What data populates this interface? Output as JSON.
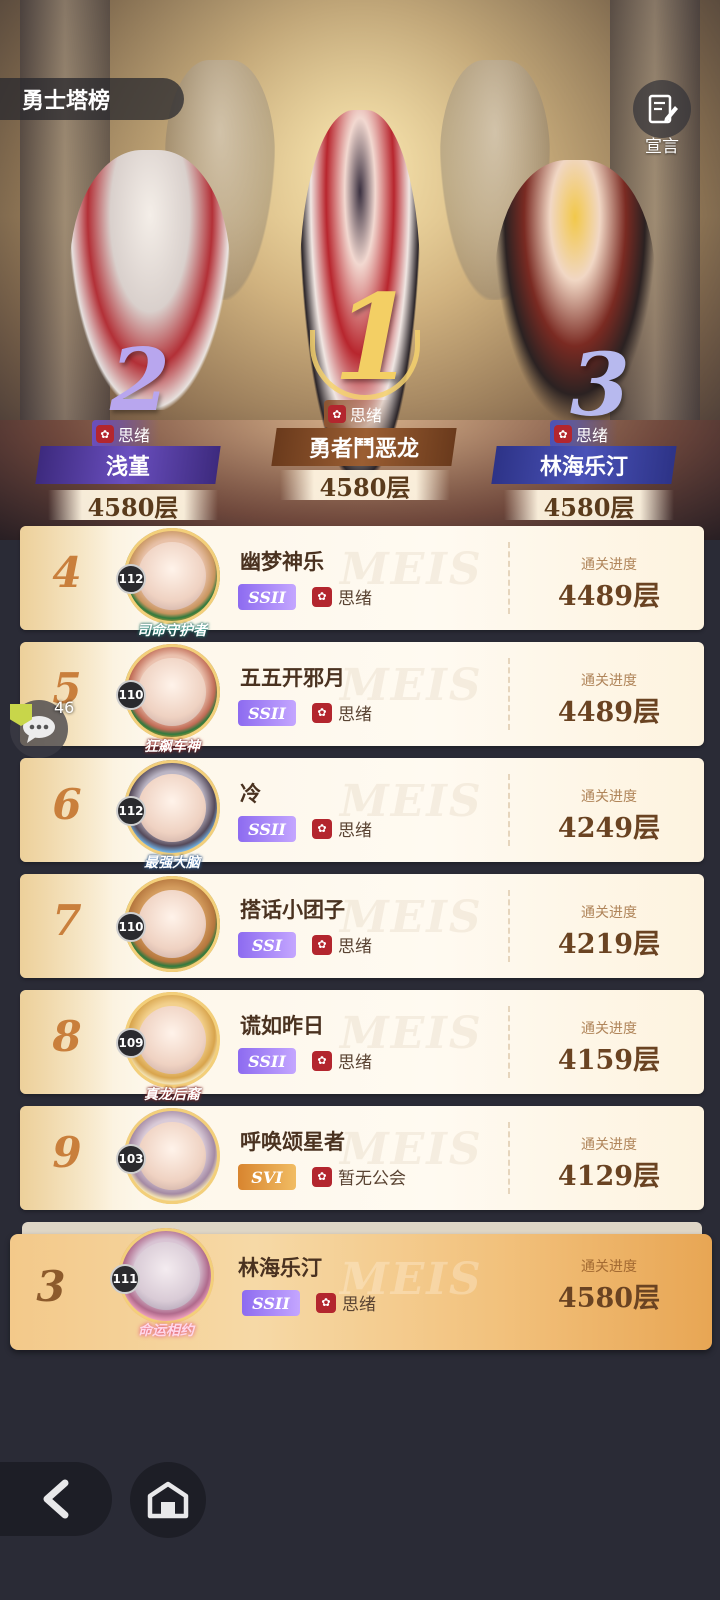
{
  "header": {
    "title": "勇士塔榜",
    "declare_label": "宣言"
  },
  "podium": [
    {
      "rank": "2",
      "guild": "思绪",
      "name": "浅堇",
      "floors": "4580层",
      "accent": "#5a3fa4"
    },
    {
      "rank": "1",
      "guild": "思绪",
      "name": "勇者鬥恶龙",
      "floors": "4580层",
      "accent": "#8a4b25"
    },
    {
      "rank": "3",
      "guild": "思绪",
      "name": "林海乐汀",
      "floors": "4580层",
      "accent": "#3f47a8"
    }
  ],
  "progress_label": "通关进度",
  "rows": [
    {
      "rank": "4",
      "level": "112",
      "name": "幽梦神乐",
      "tier": "SSII",
      "guild": "思绪",
      "floors": "4489层",
      "ribbon": "司命守护者",
      "tier_color": "purple"
    },
    {
      "rank": "5",
      "level": "110",
      "name": "五五开邪月",
      "tier": "SSII",
      "guild": "思绪",
      "floors": "4489层",
      "ribbon": "狂飙车神",
      "tier_color": "purple"
    },
    {
      "rank": "6",
      "level": "112",
      "name": "冷",
      "tier": "SSII",
      "guild": "思绪",
      "floors": "4249层",
      "ribbon": "最强大脑",
      "tier_color": "purple"
    },
    {
      "rank": "7",
      "level": "110",
      "name": "搭话小团子",
      "tier": "SSI",
      "guild": "思绪",
      "floors": "4219层",
      "ribbon": "",
      "tier_color": "purple"
    },
    {
      "rank": "8",
      "level": "109",
      "name": "谎如昨日",
      "tier": "SSII",
      "guild": "思绪",
      "floors": "4159层",
      "ribbon": "真龙后裔",
      "tier_color": "purple"
    },
    {
      "rank": "9",
      "level": "103",
      "name": "呼唤颂星者",
      "tier": "SVI",
      "guild": "暂无公会",
      "floors": "4129层",
      "ribbon": "",
      "tier_color": "gold"
    }
  ],
  "my_rank": {
    "rank": "3",
    "level": "111",
    "name": "林海乐汀",
    "tier": "SSII",
    "guild": "思绪",
    "floors": "4580层",
    "ribbon": "命运相约"
  },
  "chat": {
    "count": "46"
  },
  "icons": {
    "declare": "edit-note-icon",
    "chat": "chat-bubble-icon",
    "back": "back-arrow-icon",
    "home": "home-icon",
    "guild": "guild-rose-icon"
  }
}
